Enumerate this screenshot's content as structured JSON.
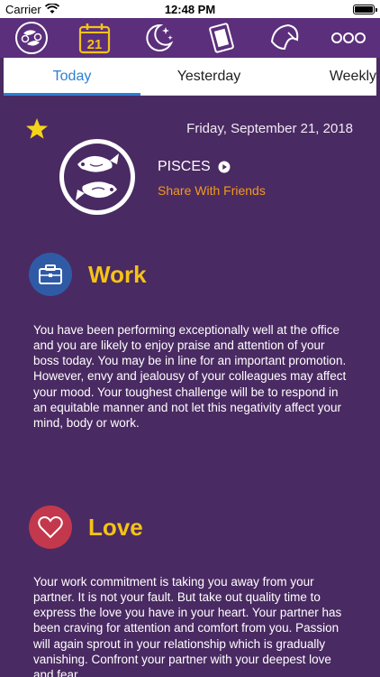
{
  "status_bar": {
    "carrier": "Carrier",
    "time": "12:48 PM"
  },
  "nav_icons": [
    {
      "name": "pisces-sign-icon"
    },
    {
      "name": "calendar-icon",
      "day": "21"
    },
    {
      "name": "moon-stars-icon"
    },
    {
      "name": "tarot-card-icon"
    },
    {
      "name": "fortune-cookie-icon"
    },
    {
      "name": "more-options-icon"
    }
  ],
  "tabs": [
    {
      "label": "Today",
      "active": true
    },
    {
      "label": "Yesterday",
      "active": false
    },
    {
      "label": "Weekly",
      "active": false
    }
  ],
  "header": {
    "date": "Friday, September 21, 2018",
    "sign": "PISCES",
    "share": "Share With Friends"
  },
  "work": {
    "title": "Work",
    "text": "You have been performing exceptionally well at the office and you are likely to enjoy praise and attention of your boss today. You may be in line for an important promotion. However, envy and jealousy of your colleagues may affect your mood. Your toughest challenge will be to respond in an equitable manner and not let this negativity affect your mind, body or work."
  },
  "love": {
    "title": "Love",
    "text": "Your work commitment is taking you away from your partner. It is not your fault. But take out quality time to express the love you have in your heart. Your partner has been craving for attention and comfort from you. Passion will again sprout in your relationship which is gradually vanishing. Confront your partner with your deepest love and fear."
  },
  "colors": {
    "background": "#4a2a62",
    "nav_bar": "#5b2f7c",
    "accent_tab": "#2b7fd4",
    "section_title": "#f5c315",
    "share_link": "#f29a1b"
  }
}
